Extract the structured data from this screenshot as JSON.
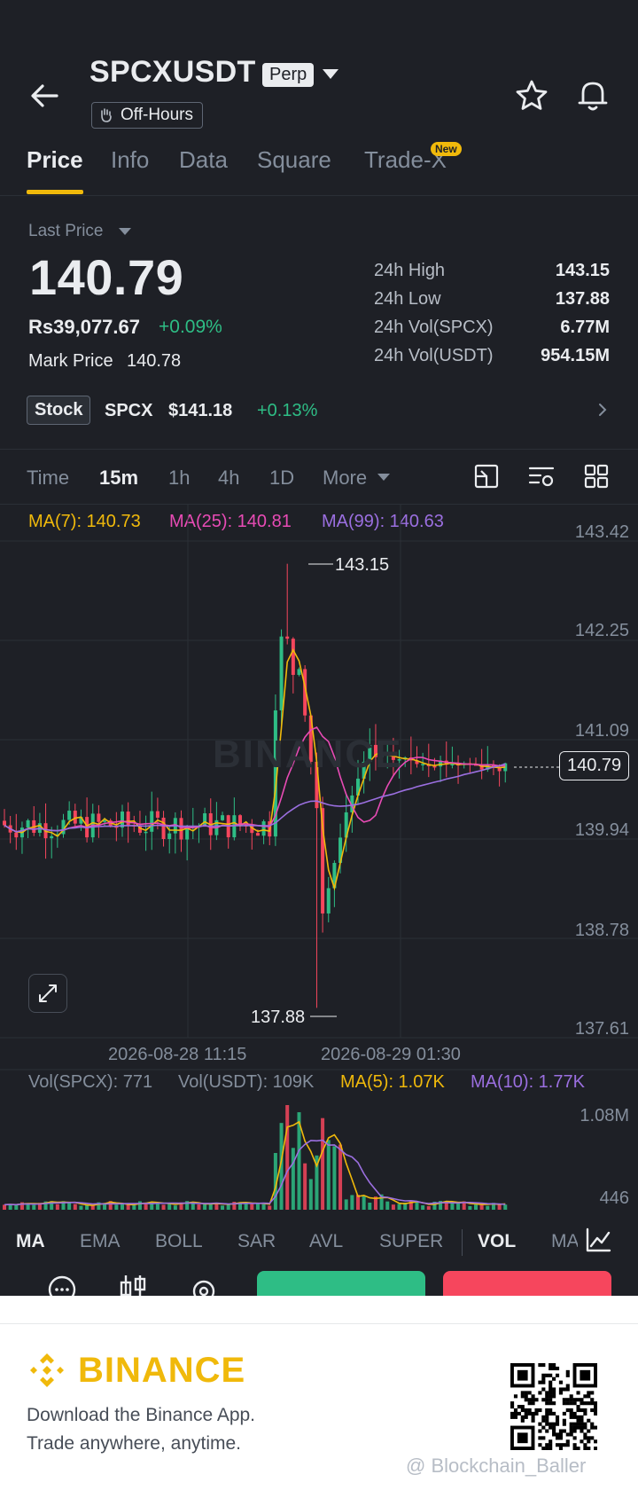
{
  "header": {
    "symbol": "SPCXUSDT",
    "contract_badge": "Perp",
    "session_badge": "Off-Hours",
    "icons": [
      "back-arrow-icon",
      "caret-down-icon",
      "star-icon",
      "bell-icon",
      "hand-icon"
    ]
  },
  "tabs": [
    {
      "label": "Price",
      "active": true
    },
    {
      "label": "Info"
    },
    {
      "label": "Data"
    },
    {
      "label": "Square"
    },
    {
      "label": "Trade-X",
      "badge": "New"
    }
  ],
  "price": {
    "label": "Last Price",
    "last": "140.79",
    "fiat": "Rs39,077.67",
    "change": "+0.09%",
    "mark_label": "Mark Price",
    "mark_value": "140.78"
  },
  "stats": [
    {
      "label": "24h High",
      "value": "143.15"
    },
    {
      "label": "24h Low",
      "value": "137.88"
    },
    {
      "label": "24h Vol(SPCX)",
      "value": "6.77M"
    },
    {
      "label": "24h Vol(USDT)",
      "value": "954.15M"
    }
  ],
  "stock": {
    "badge": "Stock",
    "symbol": "SPCX",
    "price": "$141.18",
    "change": "+0.13%"
  },
  "intervals": [
    "Time",
    "15m",
    "1h",
    "4h",
    "1D",
    "More"
  ],
  "intervals_active": "15m",
  "ma_legend": {
    "ma7": "MA(7): 140.73",
    "ma25": "MA(25): 140.81",
    "ma99": "MA(99): 140.63"
  },
  "vol_legend": {
    "spcx": "Vol(SPCX): 771",
    "usdt": "Vol(USDT): 109K",
    "ma5": "MA(5): 1.07K",
    "ma10": "MA(10): 1.77K"
  },
  "chart": {
    "high_label": "143.15",
    "low_label": "137.88",
    "price_tag": "140.79",
    "watermark": "BINANCE",
    "x_ticks": [
      "2026-08-28 11:15",
      "2026-08-29 01:30"
    ],
    "y_ticks": [
      "143.42",
      "142.25",
      "141.09",
      "139.94",
      "138.78",
      "137.61"
    ],
    "vol_ticks": [
      "1.08M",
      "446"
    ]
  },
  "colors": {
    "ma7": "#f0b90b",
    "ma25": "#e84bb5",
    "ma99": "#9b6fe0",
    "up": "#2ebd85",
    "down": "#f6465d",
    "accent": "#f0b90b"
  },
  "indicators": [
    "MA",
    "EMA",
    "BOLL",
    "SAR",
    "AVL",
    "SUPER",
    "VOL",
    "MA"
  ],
  "footer": {
    "brand": "BINANCE",
    "line1": "Download the Binance App.",
    "line2": "Trade anywhere, anytime.",
    "credit": "@ Blockchain_Baller"
  }
}
